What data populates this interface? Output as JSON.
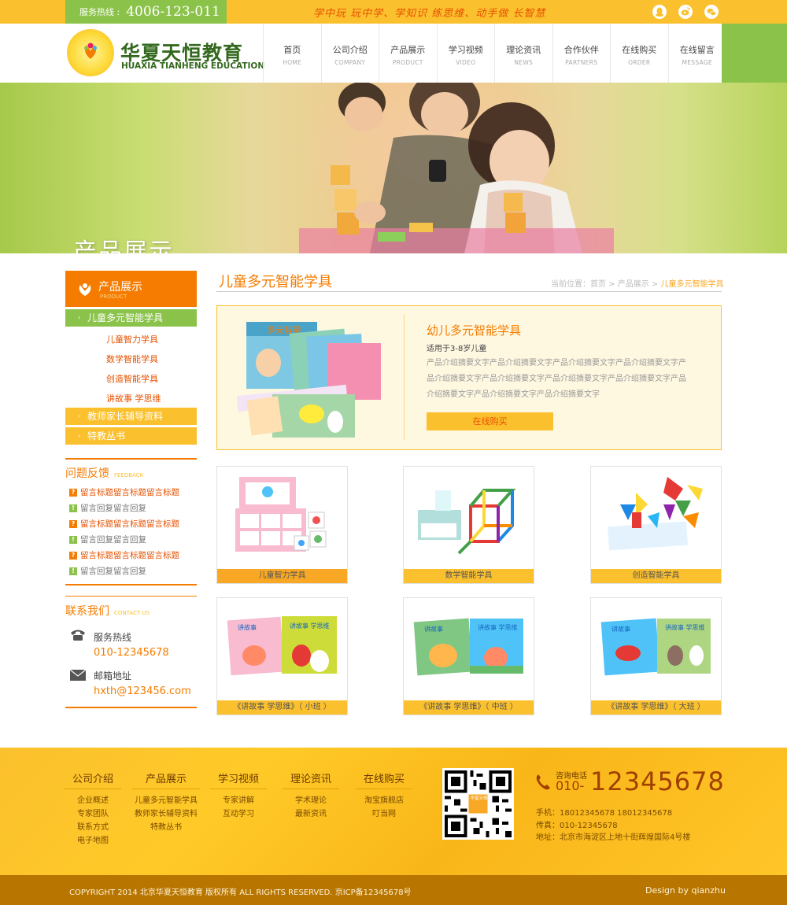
{
  "topbar": {
    "hotline_label": "服务热线 :",
    "hotline_number": "4006-123-011",
    "slogan": "学中玩 玩中学、学知识 练思维、动手做 长智慧",
    "social_icons": [
      "qq-icon",
      "weibo-icon",
      "wechat-icon"
    ]
  },
  "logo": {
    "name_cn": "华夏天恒教育",
    "name_en": "HUAXIA TIANHENG EDUCATION"
  },
  "nav": [
    {
      "cn": "首页",
      "en": "HOME"
    },
    {
      "cn": "公司介绍",
      "en": "COMPANY"
    },
    {
      "cn": "产品展示",
      "en": "PRODUCT"
    },
    {
      "cn": "学习视频",
      "en": "VIDEO"
    },
    {
      "cn": "理论资讯",
      "en": "NEWS"
    },
    {
      "cn": "合作伙伴",
      "en": "PARTNERS"
    },
    {
      "cn": "在线购买",
      "en": "ORDER"
    },
    {
      "cn": "在线留言",
      "en": "MESSAGE"
    }
  ],
  "banner": {
    "title": "产品展示"
  },
  "sidebar": {
    "product_title": "产品展示",
    "product_title_en": "PRODUCT",
    "categories": [
      {
        "label": "儿童多元智能学具",
        "active": true
      },
      {
        "label": "教师家长辅导资料"
      },
      {
        "label": "特教丛书"
      }
    ],
    "subcategories": [
      "儿童智力学具",
      "数学智能学具",
      "创造智能学具",
      "讲故事 学思维"
    ],
    "feedback_title": "问题反馈",
    "feedback_title_en": "FEEDBACK",
    "feedback": [
      {
        "type": "q",
        "badge": "?",
        "text": "留言标题留言标题留言标题"
      },
      {
        "type": "a",
        "badge": "!",
        "text": "留言回复留言回复"
      },
      {
        "type": "q",
        "badge": "?",
        "text": "留言标题留言标题留言标题"
      },
      {
        "type": "a",
        "badge": "!",
        "text": "留言回复留言回复"
      },
      {
        "type": "q",
        "badge": "?",
        "text": "留言标题留言标题留言标题"
      },
      {
        "type": "a",
        "badge": "!",
        "text": "留言回复留言回复"
      }
    ],
    "contact_title": "联系我们",
    "contact_title_en": "CONTACT US",
    "phone_label": "服务热线",
    "phone": "010-12345678",
    "email_label": "邮箱地址",
    "email": "hxth@123456.com"
  },
  "main": {
    "title": "儿童多元智能学具",
    "breadcrumb_prefix": "当前位置：首页 > 产品展示 > ",
    "breadcrumb_current": "儿童多元智能学具",
    "featured": {
      "name": "幼儿多元智能学具",
      "age": "适用于3-8岁儿童",
      "description": "产品介绍摘要文字产品介绍摘要文字产品介绍摘要文字产品介绍摘要文字产品介绍摘要文字产品介绍摘要文字产品介绍摘要文字产品介绍摘要文字产品介绍摘要文字产品介绍摘要文字产品介绍摘要文字",
      "buy_label": "在线购买"
    },
    "products": [
      {
        "caption": "儿童智力学具",
        "cap_color": "#f9a825"
      },
      {
        "caption": "数学智能学具",
        "cap_color": "#fbc02d"
      },
      {
        "caption": "创造智能学具",
        "cap_color": "#fbc02d"
      },
      {
        "caption": "《讲故事 学思维》（ 小班 ）",
        "cap_color": "#fbc02d"
      },
      {
        "caption": "《讲故事 学思维》（ 中班 ）",
        "cap_color": "#fbc02d"
      },
      {
        "caption": "《讲故事 学思维》（ 大班 ）",
        "cap_color": "#fbc02d"
      }
    ]
  },
  "footer": {
    "columns": [
      {
        "title": "公司介绍",
        "items": [
          "企业概述",
          "专家团队",
          "联系方式",
          "电子地图"
        ]
      },
      {
        "title": "产品展示",
        "items": [
          "儿童多元智能学具",
          "教师家长辅导资料",
          "特教丛书"
        ]
      },
      {
        "title": "学习视频",
        "items": [
          "专家讲解",
          "互动学习"
        ]
      },
      {
        "title": "理论资讯",
        "items": [
          "学术理论",
          "最新资讯"
        ]
      },
      {
        "title": "在线购买",
        "items": [
          "淘宝旗舰店",
          "叮当网"
        ]
      }
    ],
    "qr_text": "华夏天恒",
    "consult_label": "咨询电话",
    "consult_area": "010-",
    "consult_number": "12345678",
    "mobile": "手机：18012345678  18012345678",
    "fax": "传真：010-12345678",
    "address": "地址：北京市海淀区上地十街辉煌国际4号楼",
    "copyright": "COPYRIGHT 2014 北京华夏天恒教育 版权所有 ALL RIGHTS RESERVED.   京ICP备12345678号",
    "design": "Design by qianzhu"
  }
}
